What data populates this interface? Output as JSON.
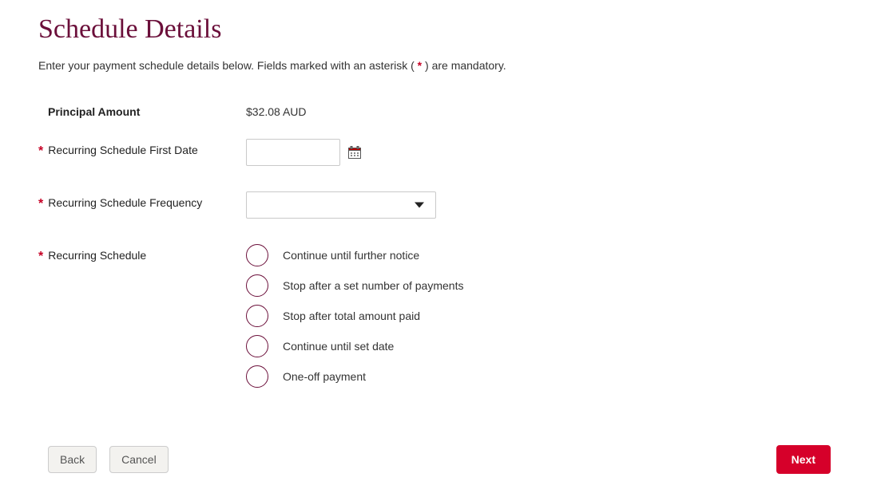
{
  "title": "Schedule Details",
  "intro_before": "Enter your payment schedule details below. Fields marked with an asterisk ( ",
  "intro_mark": "*",
  "intro_after": " ) are mandatory.",
  "principal": {
    "label": "Principal Amount",
    "value": "$32.08 AUD"
  },
  "first_date": {
    "label": "Recurring Schedule First Date",
    "value": ""
  },
  "frequency": {
    "label": "Recurring Schedule Frequency",
    "selected": ""
  },
  "schedule": {
    "label": "Recurring Schedule",
    "options": [
      "Continue until further notice",
      "Stop after a set number of payments",
      "Stop after total amount paid",
      "Continue until set date",
      "One-off payment"
    ]
  },
  "buttons": {
    "back": "Back",
    "cancel": "Cancel",
    "next": "Next"
  }
}
